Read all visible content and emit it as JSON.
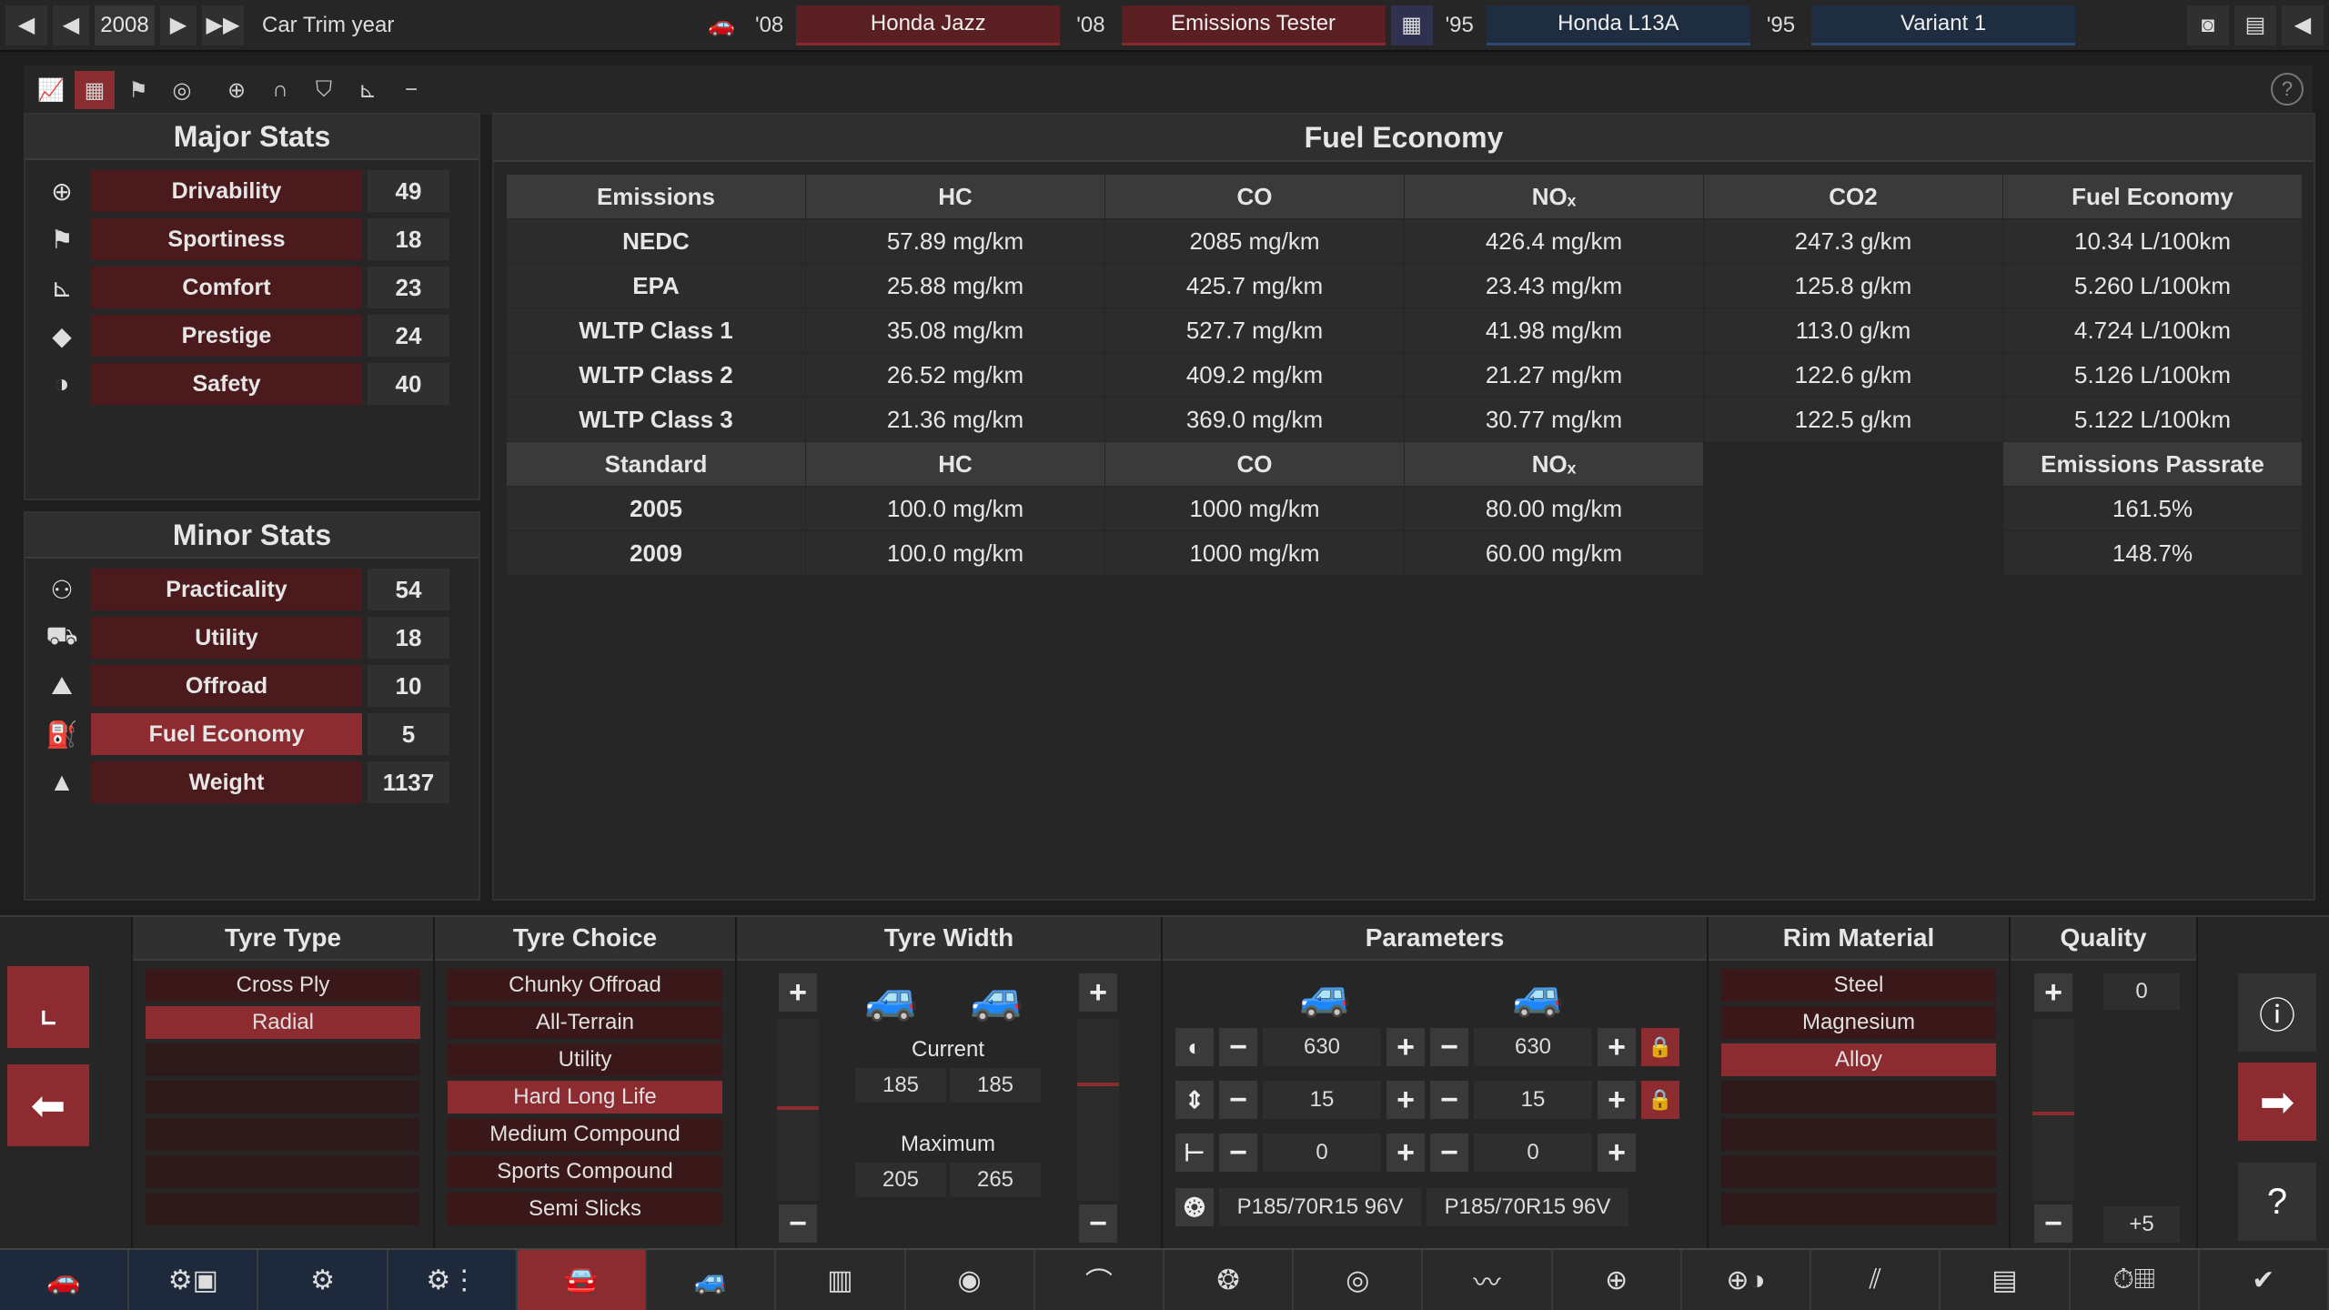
{
  "topbar": {
    "year": "2008",
    "trim_label": "Car Trim year",
    "car_year": "'08",
    "car_name": "Honda Jazz",
    "trim_year": "'08",
    "trim_name": "Emissions Tester",
    "engine_year": "'95",
    "engine_name": "Honda L13A",
    "variant_year": "'95",
    "variant_name": "Variant 1"
  },
  "major_stats": {
    "title": "Major Stats",
    "items": [
      {
        "label": "Drivability",
        "value": "49",
        "icon": "steering-wheel-icon"
      },
      {
        "label": "Sportiness",
        "value": "18",
        "icon": "checkered-flag-icon"
      },
      {
        "label": "Comfort",
        "value": "23",
        "icon": "seat-icon"
      },
      {
        "label": "Prestige",
        "value": "24",
        "icon": "diamond-icon"
      },
      {
        "label": "Safety",
        "value": "40",
        "icon": "safety-icon"
      }
    ]
  },
  "minor_stats": {
    "title": "Minor Stats",
    "items": [
      {
        "label": "Practicality",
        "value": "54",
        "icon": "people-icon"
      },
      {
        "label": "Utility",
        "value": "18",
        "icon": "truck-icon"
      },
      {
        "label": "Offroad",
        "value": "10",
        "icon": "offroad-icon"
      },
      {
        "label": "Fuel Economy",
        "value": "5",
        "icon": "fuel-icon"
      },
      {
        "label": "Weight",
        "value": "1137",
        "icon": "weight-icon"
      }
    ]
  },
  "fuel": {
    "title": "Fuel Economy",
    "emission_headers": [
      "Emissions",
      "HC",
      "CO",
      "NOₓ",
      "CO2",
      "Fuel Economy"
    ],
    "emission_rows": [
      [
        "NEDC",
        "57.89 mg/km",
        "2085 mg/km",
        "426.4 mg/km",
        "247.3 g/km",
        "10.34 L/100km"
      ],
      [
        "EPA",
        "25.88 mg/km",
        "425.7 mg/km",
        "23.43 mg/km",
        "125.8 g/km",
        "5.260 L/100km"
      ],
      [
        "WLTP Class 1",
        "35.08 mg/km",
        "527.7 mg/km",
        "41.98 mg/km",
        "113.0 g/km",
        "4.724 L/100km"
      ],
      [
        "WLTP Class 2",
        "26.52 mg/km",
        "409.2 mg/km",
        "21.27 mg/km",
        "122.6 g/km",
        "5.126 L/100km"
      ],
      [
        "WLTP Class 3",
        "21.36 mg/km",
        "369.0 mg/km",
        "30.77 mg/km",
        "122.5 g/km",
        "5.122 L/100km"
      ]
    ],
    "standard_headers": [
      "Standard",
      "HC",
      "CO",
      "NOₓ",
      "",
      "Emissions Passrate"
    ],
    "standard_rows": [
      [
        "2005",
        "100.0 mg/km",
        "1000 mg/km",
        "80.00 mg/km",
        "",
        "161.5%"
      ],
      [
        "2009",
        "100.0 mg/km",
        "1000 mg/km",
        "60.00 mg/km",
        "",
        "148.7%"
      ]
    ]
  },
  "tyre_type": {
    "title": "Tyre Type",
    "options": [
      "Cross Ply",
      "Radial"
    ],
    "selected": 1
  },
  "tyre_choice": {
    "title": "Tyre Choice",
    "options": [
      "Chunky Offroad",
      "All-Terrain",
      "Utility",
      "Hard Long Life",
      "Medium Compound",
      "Sports Compound",
      "Semi Slicks"
    ],
    "selected": 3
  },
  "tyre_width": {
    "title": "Tyre Width",
    "current_label": "Current",
    "current_front": "185",
    "current_rear": "185",
    "maximum_label": "Maximum",
    "max_front": "205",
    "max_rear": "265"
  },
  "parameters": {
    "title": "Parameters",
    "row1_front": "630",
    "row1_rear": "630",
    "row2_front": "15",
    "row2_rear": "15",
    "row3_front": "0",
    "row3_rear": "0",
    "tyre_front": "P185/70R15 96V",
    "tyre_rear": "P185/70R15  96V"
  },
  "rim_material": {
    "title": "Rim Material",
    "options": [
      "Steel",
      "Magnesium",
      "Alloy"
    ],
    "selected": 2
  },
  "quality": {
    "title": "Quality",
    "value": "0",
    "bonus": "+5"
  },
  "colors": {
    "accent": "#8c2b30",
    "dark_red": "#4a1a1d",
    "blue": "#1f2d40"
  }
}
